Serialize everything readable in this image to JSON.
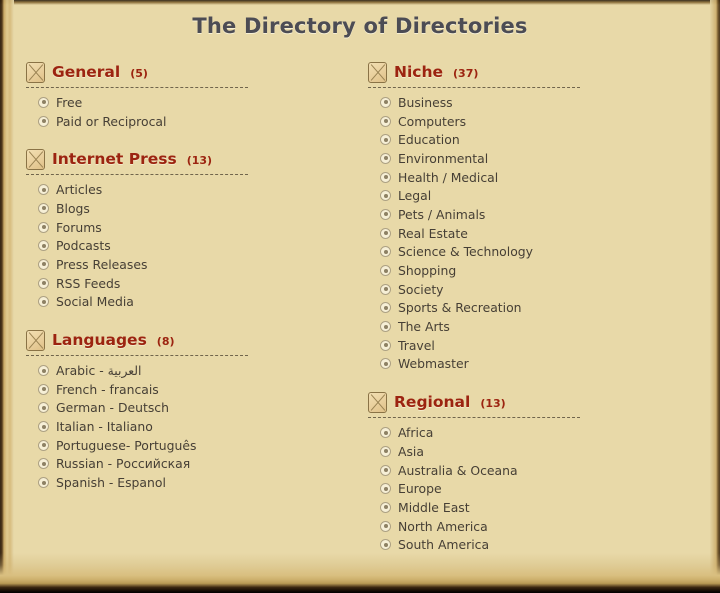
{
  "header": {
    "title": "The Directory of Directories",
    "title_color": "#4c4c54"
  },
  "theme": {
    "heading_color": "#9c2410",
    "text_color": "#463f35",
    "paper_color": "#f2e7c2",
    "rule_color": "#5c513c"
  },
  "icons": {
    "category": "broken-image-icon",
    "bullet": "circle-bullet-icon"
  },
  "columns": [
    {
      "name": "left",
      "categories": [
        {
          "title": "General",
          "count": "(5)",
          "items": [
            "Free",
            "Paid or Reciprocal"
          ]
        },
        {
          "title": "Internet Press",
          "count": "(13)",
          "items": [
            "Articles",
            "Blogs",
            "Forums",
            "Podcasts",
            "Press Releases",
            "RSS Feeds",
            "Social Media"
          ]
        },
        {
          "title": "Languages",
          "count": "(8)",
          "items": [
            "Arabic - العربية",
            "French - francais",
            "German - Deutsch",
            "Italian - Italiano",
            "Portuguese- Português",
            "Russian - Российская",
            "Spanish - Espanol"
          ]
        }
      ]
    },
    {
      "name": "right",
      "categories": [
        {
          "title": "Niche",
          "count": "(37)",
          "items": [
            "Business",
            "Computers",
            "Education",
            "Environmental",
            "Health / Medical",
            "Legal",
            "Pets / Animals",
            "Real Estate",
            "Science & Technology",
            "Shopping",
            "Society",
            "Sports & Recreation",
            "The Arts",
            "Travel",
            "Webmaster"
          ]
        },
        {
          "title": "Regional",
          "count": "(13)",
          "items": [
            "Africa",
            "Asia",
            "Australia & Oceana",
            "Europe",
            "Middle East",
            "North America",
            "South America"
          ]
        }
      ]
    }
  ]
}
